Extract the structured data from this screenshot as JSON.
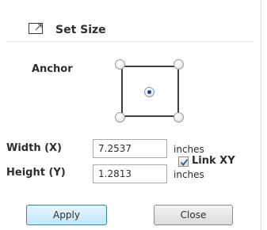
{
  "header": {
    "title": "Set Size",
    "icon": "resize-box-icon"
  },
  "anchor": {
    "label": "Anchor",
    "options": [
      "top-left",
      "top-right",
      "center",
      "bottom-left",
      "bottom-right"
    ],
    "selected": "center"
  },
  "width": {
    "label": "Width (X)",
    "value": "7.2537",
    "unit": "inches"
  },
  "height": {
    "label": "Height (Y)",
    "value": "1.2813",
    "unit": "inches"
  },
  "link_xy": {
    "label": "Link XY",
    "checked": true
  },
  "buttons": {
    "apply": "Apply",
    "close": "Close"
  },
  "colors": {
    "apply_border": "#3c7fb1",
    "radio_dot": "#1f4b7a"
  }
}
